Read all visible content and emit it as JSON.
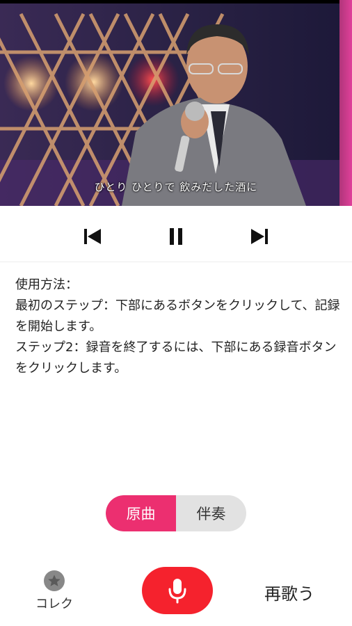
{
  "video": {
    "subtitle": "ひとり ひとりで 飲みだした酒に"
  },
  "player": {
    "prev_icon": "skip-previous-icon",
    "pause_icon": "pause-icon",
    "next_icon": "skip-next-icon"
  },
  "instructions": {
    "heading": "使用方法：",
    "step1": "最初のステップ：下部にあるボタンをクリックして、記録を開始します。",
    "step2": "ステップ2：録音を終了するには、下部にある録音ボタンをクリックします。"
  },
  "toggle": {
    "original": "原曲",
    "accompaniment": "伴奏",
    "selected": "原曲"
  },
  "bottom": {
    "collect_label": "コレク",
    "collect_icon": "star-icon",
    "mic_icon": "microphone-icon",
    "resing_label": "再歌う"
  },
  "colors": {
    "accent": "#ec2f70",
    "record": "#f5222d"
  }
}
